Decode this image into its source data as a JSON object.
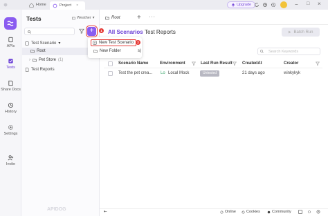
{
  "topbar": {
    "tabs": [
      {
        "label": "Home",
        "icon": "home-icon"
      },
      {
        "label": "Project",
        "icon": "project-icon"
      }
    ],
    "upgrade_label": "Upgrade"
  },
  "rail": {
    "items": [
      {
        "label": "APIs",
        "icon": "apis-icon"
      },
      {
        "label": "Tests",
        "icon": "tests-icon"
      },
      {
        "label": "Share Docs",
        "icon": "share-docs-icon"
      },
      {
        "label": "History",
        "icon": "history-icon"
      },
      {
        "label": "Settings",
        "icon": "settings-icon"
      },
      {
        "label": "Invite",
        "icon": "invite-icon"
      }
    ],
    "active": "Tests"
  },
  "sidebar": {
    "title": "Tests",
    "environment": "Weather",
    "add_label": "+",
    "tree": {
      "section_label": "Test Scenario",
      "root_label": "Root",
      "folder_label": "Pet Store",
      "folder_count": "(1)",
      "reports_label": "Test Reports"
    },
    "watermark": "APIDOG"
  },
  "breadcrumb": {
    "label": "Root",
    "plus": "+",
    "more": "···"
  },
  "main": {
    "tabs": [
      {
        "label": "All Scenarios",
        "active": true
      },
      {
        "label": "Test Reports",
        "active": false
      }
    ],
    "batch_run_label": "Batch Run",
    "search_placeholder": "Search Keywords",
    "table": {
      "columns": [
        "Scenario Name",
        "Environment",
        "Last Run Result",
        "CreatedAt",
        "Creator"
      ],
      "rows": [
        {
          "name": "Test the pet crea...",
          "environment": "Local Mock",
          "env_prefix": "Lo",
          "last_run": "Untested",
          "created_at": "21 days ago",
          "creator": "winkykyk"
        }
      ]
    }
  },
  "menu": {
    "items": [
      {
        "label": "New Test Scenario",
        "icon": "new-scenario-icon",
        "highlighted": true
      },
      {
        "label": "New Folder",
        "icon": "new-folder-icon",
        "highlighted": false
      }
    ],
    "suffix": "s)"
  },
  "annotations": {
    "badge_1": "1",
    "badge_2": "2"
  },
  "statusbar": {
    "collapse": "⇤",
    "online": "Online",
    "cookies": "Cookies",
    "community": "Community"
  },
  "colors": {
    "accent": "#8a5cf0",
    "highlight": "#e53935",
    "selected_row": "#ececf3"
  }
}
